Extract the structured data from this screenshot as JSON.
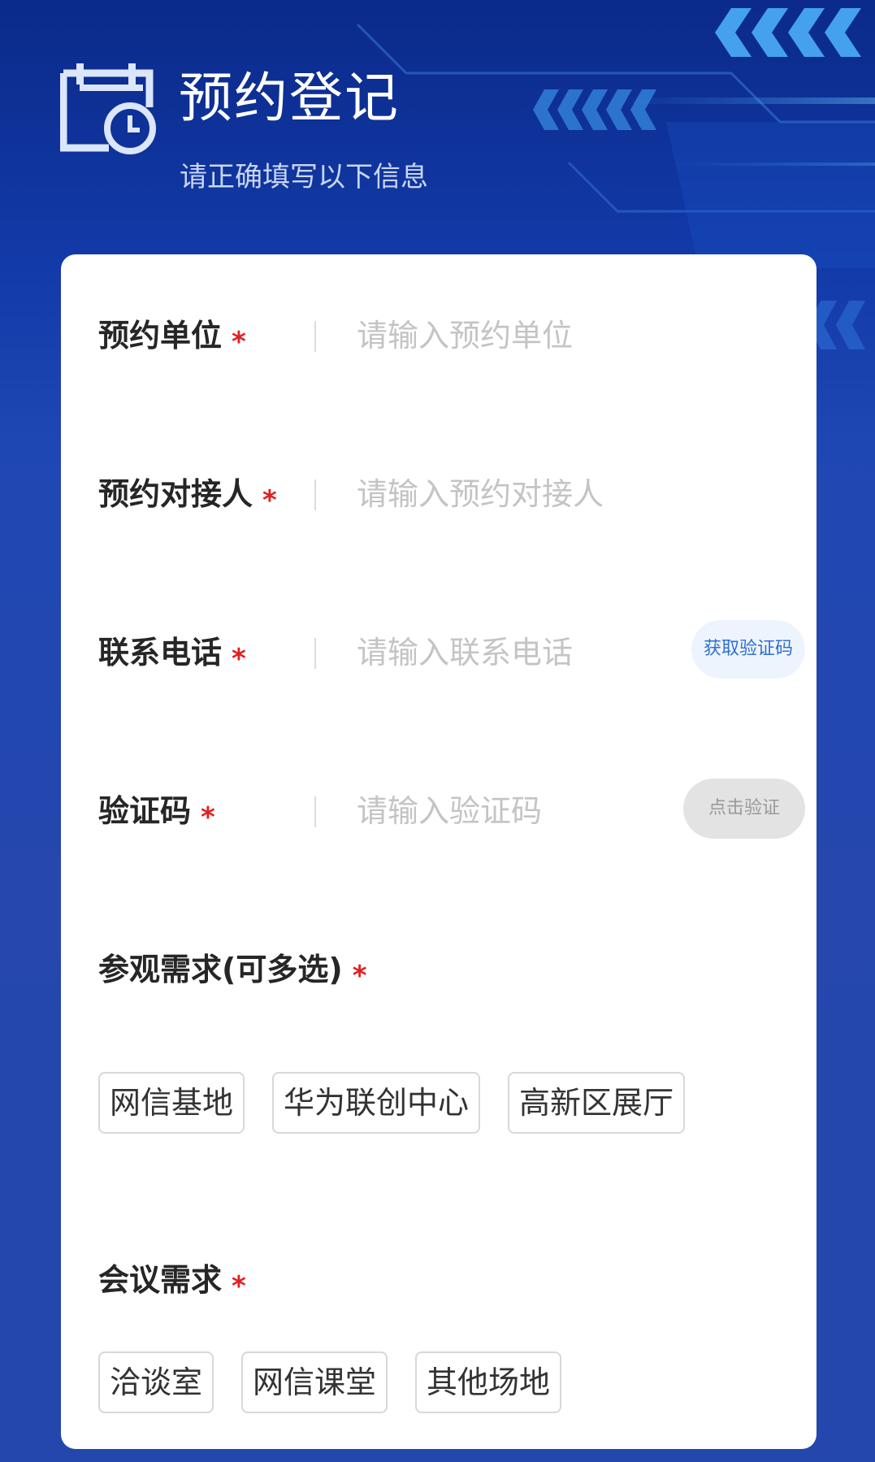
{
  "header": {
    "title": "预约登记",
    "subtitle": "请正确填写以下信息",
    "icon": "calendar-clock-icon"
  },
  "form": {
    "required_mark": "*",
    "fields": [
      {
        "label": "预约单位",
        "placeholder": "请输入预约单位",
        "value": ""
      },
      {
        "label": "预约对接人",
        "placeholder": "请输入预约对接人",
        "value": ""
      },
      {
        "label": "联系电话",
        "placeholder": "请输入联系电话",
        "value": "",
        "action_label": "获取验证码"
      },
      {
        "label": "验证码",
        "placeholder": "请输入验证码",
        "value": "",
        "action_label": "点击验证"
      }
    ],
    "visit_needs": {
      "label": "参观需求(可多选)",
      "options": [
        "网信基地",
        "华为联创中心",
        "高新区展厅"
      ]
    },
    "meeting_needs": {
      "label": "会议需求",
      "options": [
        "洽谈室",
        "网信课堂",
        "其他场地"
      ]
    }
  },
  "colors": {
    "background": "#2347ad",
    "required": "#e02020",
    "sms_button_text": "#2f6fd0",
    "verify_button_bg": "#e3e3e3"
  }
}
